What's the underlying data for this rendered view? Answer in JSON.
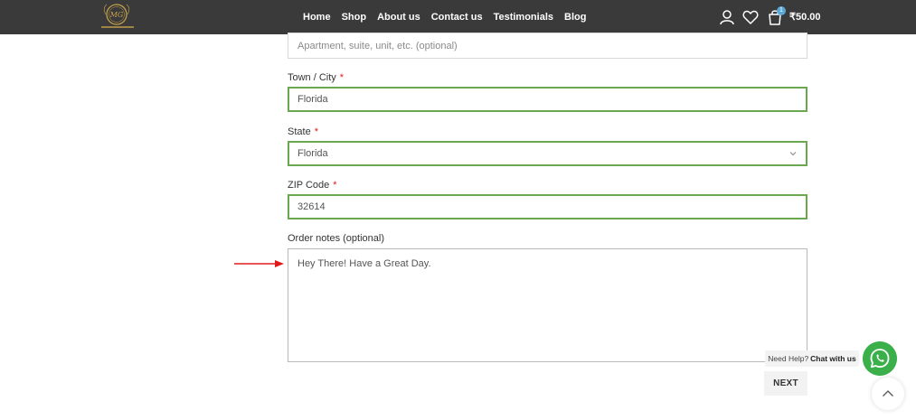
{
  "header": {
    "nav": [
      "Home",
      "Shop",
      "About us",
      "Contact us",
      "Testimonials",
      "Blog"
    ],
    "cart_count": "1",
    "cart_total": "₹50.00",
    "icons": [
      "user-icon",
      "heart-icon",
      "cart-icon"
    ],
    "bg_color": "#3a3a3a"
  },
  "form": {
    "apartment": {
      "placeholder": "Apartment, suite, unit, etc. (optional)"
    },
    "city": {
      "label": "Town / City",
      "value": "Florida"
    },
    "state": {
      "label": "State",
      "value": "Florida"
    },
    "zip": {
      "label": "ZIP Code",
      "value": "32614"
    },
    "notes": {
      "label": "Order notes (optional)",
      "value": "Hey There! Have a Great Day."
    },
    "required_mark": "*",
    "valid_border_color": "#6aa84f"
  },
  "help": {
    "prefix": "Need Help?",
    "cta": "Chat with us"
  },
  "next_label": "NEXT",
  "accent": {
    "whatsapp": "#3bb04a",
    "arrow": "#e01a1a"
  }
}
